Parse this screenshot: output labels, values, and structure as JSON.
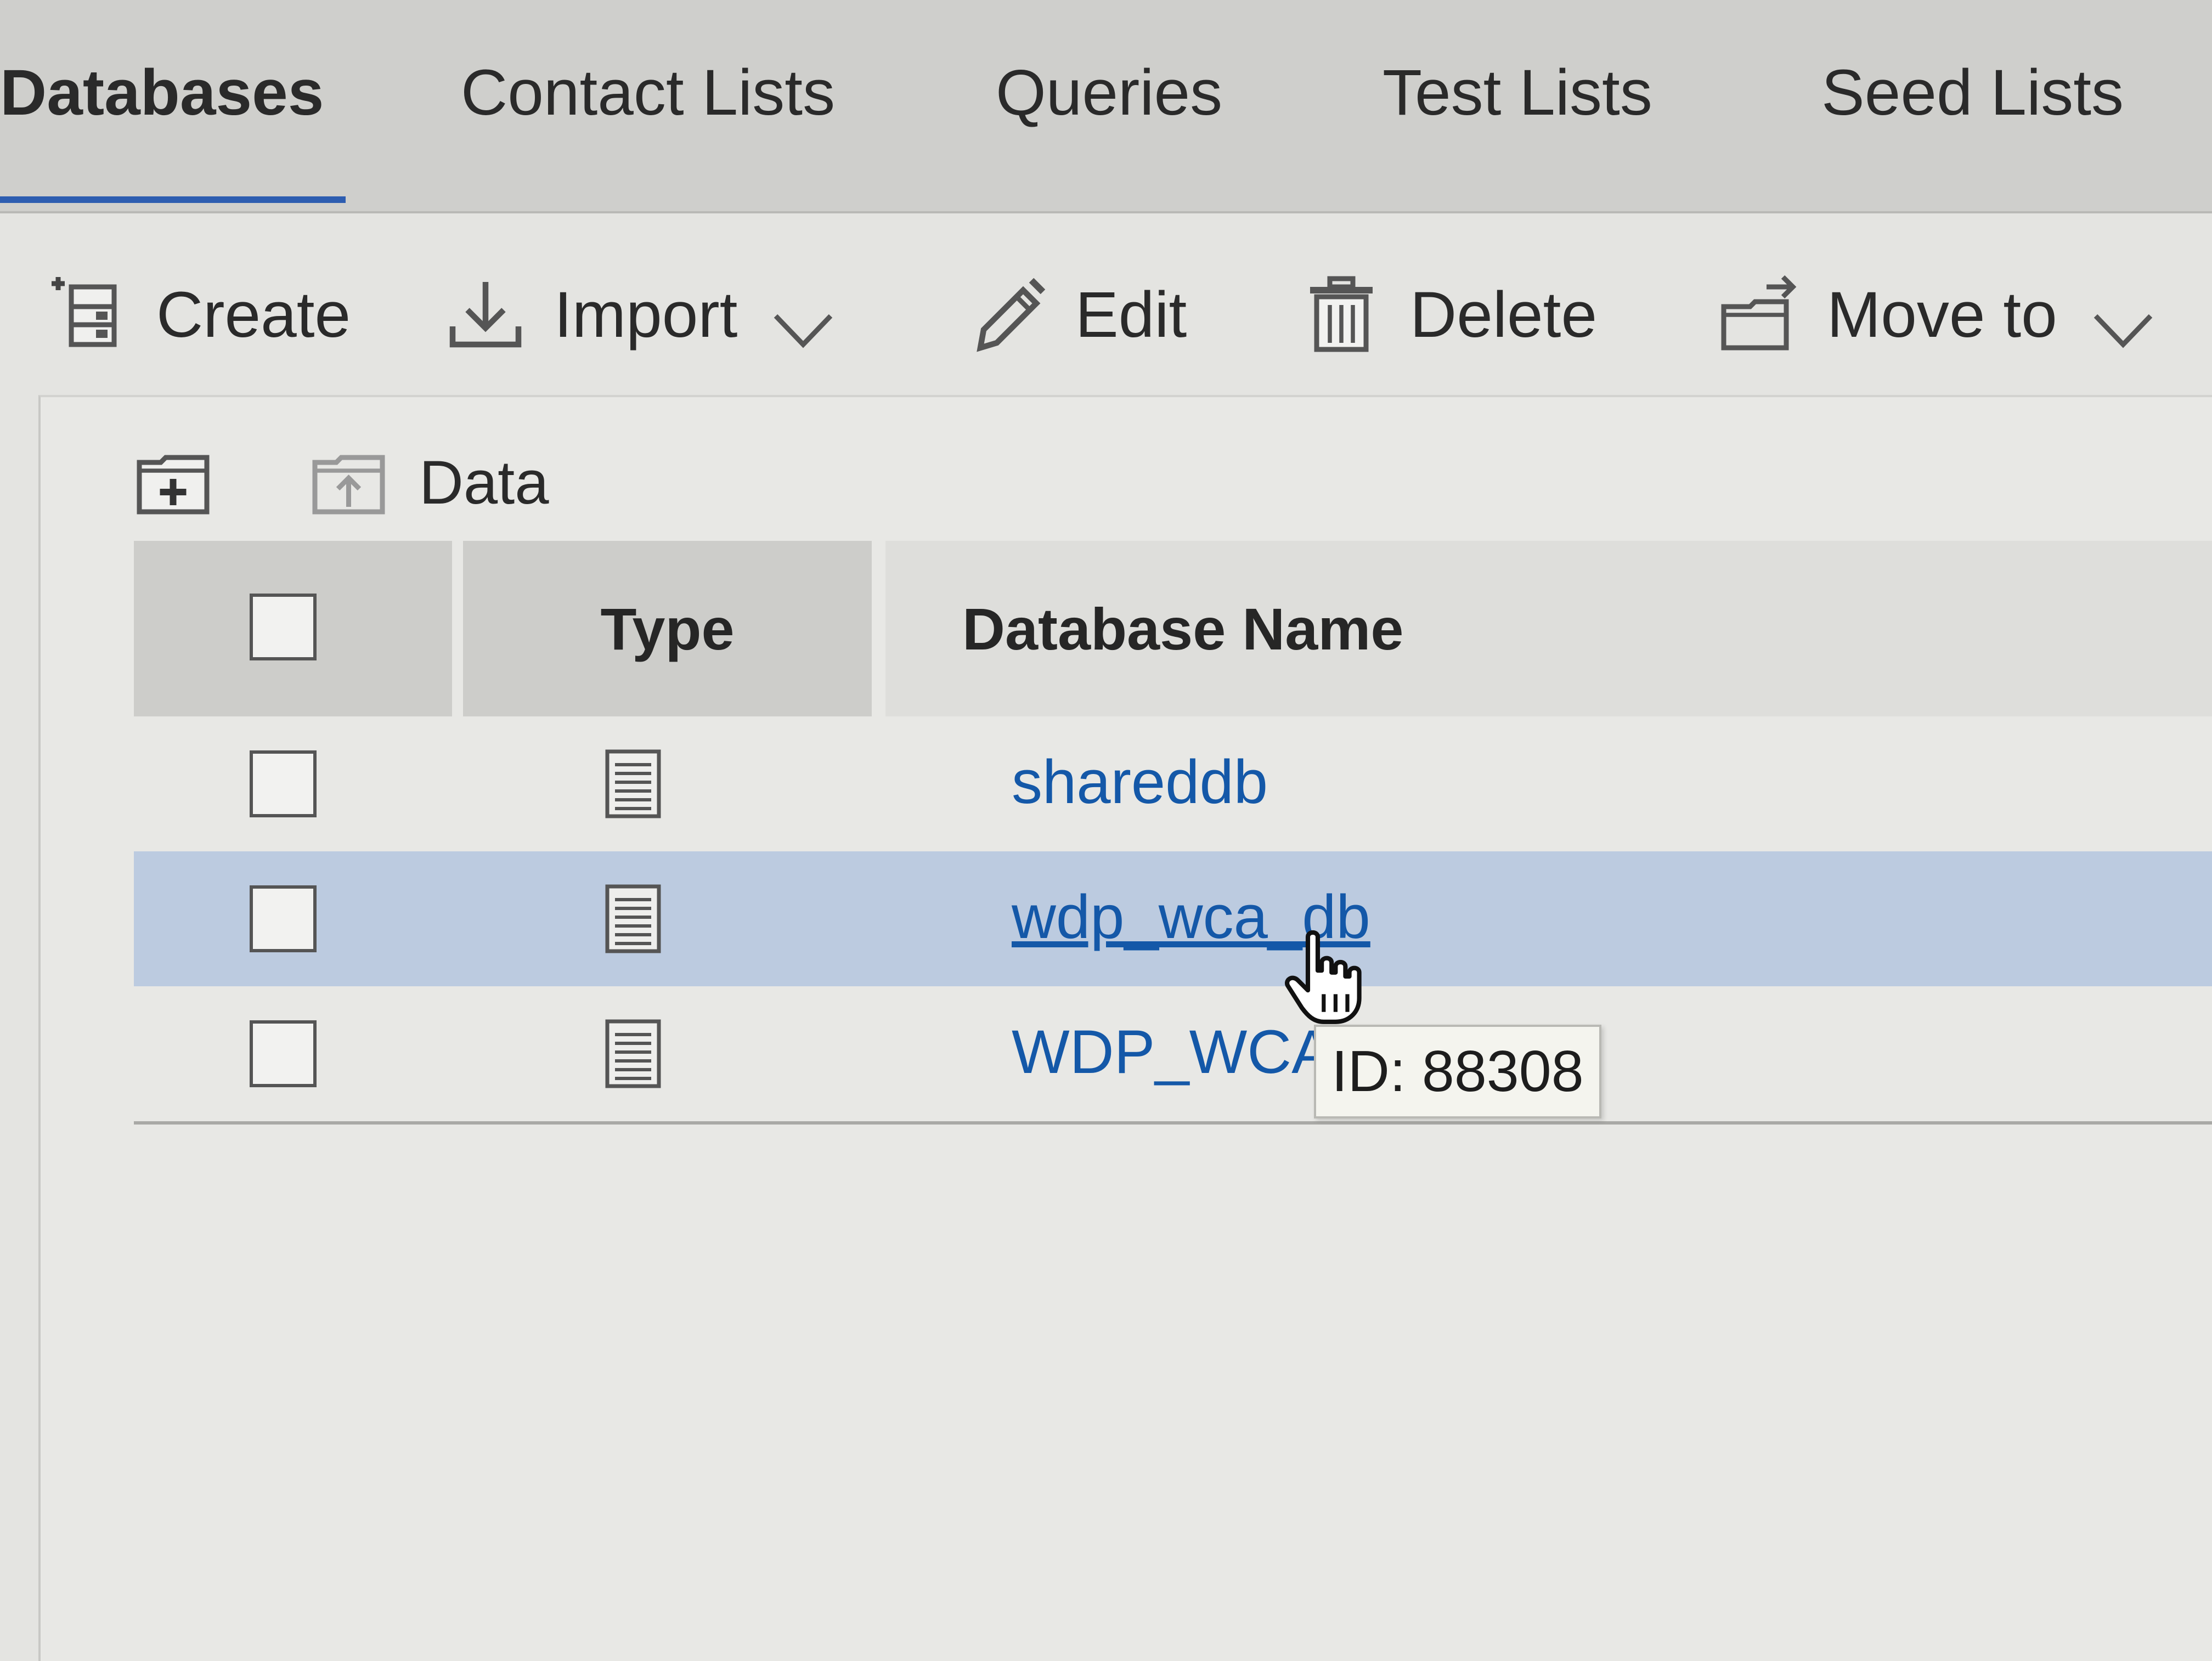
{
  "tabs": [
    {
      "label": "Databases",
      "active": true
    },
    {
      "label": "Contact Lists",
      "active": false
    },
    {
      "label": "Queries",
      "active": false
    },
    {
      "label": "Test Lists",
      "active": false
    },
    {
      "label": "Seed Lists",
      "active": false
    }
  ],
  "toolbar": {
    "create": {
      "label": "Create",
      "icon": "create-database-icon"
    },
    "import": {
      "label": "Import",
      "icon": "download-icon"
    },
    "edit": {
      "label": "Edit",
      "icon": "pencil-icon"
    },
    "delete": {
      "label": "Delete",
      "icon": "trash-icon"
    },
    "move_to": {
      "label": "Move to",
      "icon": "move-folder-icon"
    }
  },
  "folder_nav": {
    "new_folder_icon": "new-folder-icon",
    "up_folder_icon": "folder-up-icon",
    "current_folder": "Data"
  },
  "table": {
    "columns": {
      "type": "Type",
      "name": "Database Name"
    },
    "rows": [
      {
        "name": "shareddb",
        "hovered": false
      },
      {
        "name": "wdp_wca_db",
        "hovered": true
      },
      {
        "name": "WDP_WCA_I",
        "hovered": false
      }
    ]
  },
  "tooltip": {
    "text": "ID: 88308"
  },
  "colors": {
    "link": "#1458a8",
    "tab_underline": "#2d5db0",
    "row_hover": "#bccbe0"
  }
}
